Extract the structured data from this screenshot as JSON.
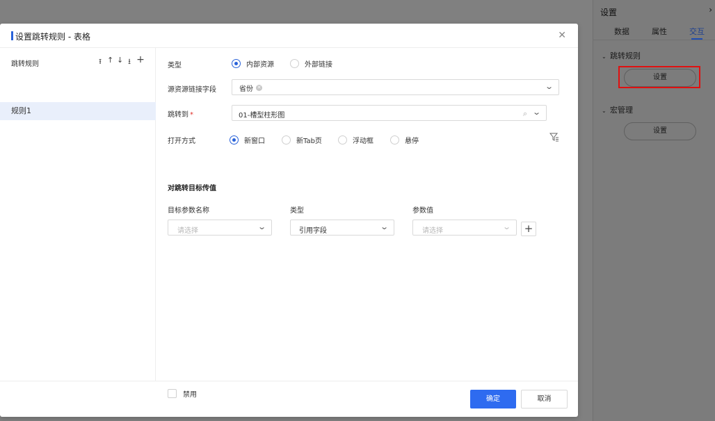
{
  "dialog": {
    "title": "设置跳转规则 - 表格",
    "close_icon": "close-icon"
  },
  "rules_panel": {
    "header": "跳转规则",
    "tools": [
      "⭱",
      "↑",
      "↓",
      "⭳",
      "+"
    ],
    "items": [
      {
        "label": "规则1",
        "selected": true
      }
    ]
  },
  "form": {
    "type": {
      "label": "类型",
      "options": [
        {
          "label": "内部资源",
          "checked": true
        },
        {
          "label": "外部链接",
          "checked": false
        }
      ]
    },
    "source_field": {
      "label": "源资源链接字段",
      "tag": "省份"
    },
    "jump_to": {
      "label": "跳转到",
      "required_mark": "*",
      "value": "01-槽型柱形图"
    },
    "open_mode": {
      "label": "打开方式",
      "options": [
        {
          "label": "新窗口",
          "checked": true
        },
        {
          "label": "新Tab页",
          "checked": false
        },
        {
          "label": "浮动框",
          "checked": false
        },
        {
          "label": "悬停",
          "checked": false
        }
      ]
    },
    "params": {
      "title": "对跳转目标传值",
      "columns": [
        "目标参数名称",
        "类型",
        "参数值"
      ],
      "row": {
        "name_placeholder": "请选择",
        "type_value": "引用字段",
        "value_placeholder": "请选择"
      }
    },
    "disable_label": "禁用"
  },
  "footer": {
    "confirm": "确定",
    "cancel": "取消"
  },
  "side_panel": {
    "title": "设置",
    "close": "›",
    "tabs": [
      {
        "label": "数据",
        "active": false
      },
      {
        "label": "属性",
        "active": false
      },
      {
        "label": "交互",
        "active": true
      }
    ],
    "sections": [
      {
        "label": "跳转规则",
        "button": "设置"
      },
      {
        "label": "宏管理",
        "button": "设置"
      }
    ],
    "highlight_color": "#e01010"
  },
  "colors": {
    "accent": "#2962d9",
    "primary_button": "#2e6bf0"
  }
}
